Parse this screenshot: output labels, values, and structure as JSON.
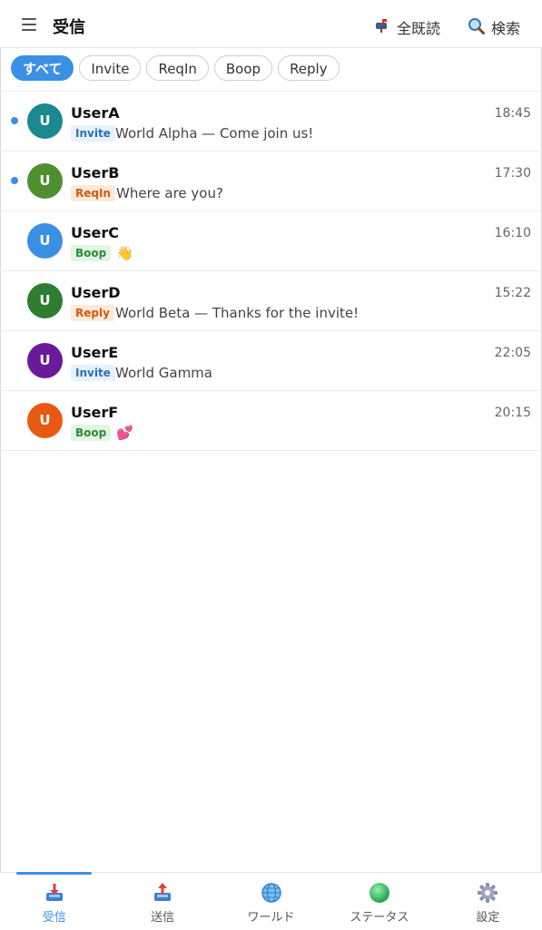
{
  "header": {
    "title": "受信",
    "mark_all_read": "全既読",
    "search": "検索"
  },
  "filters": [
    "すべて",
    "Invite",
    "ReqIn",
    "Boop",
    "Reply"
  ],
  "messages": [
    {
      "user": "UserA",
      "initial": "U",
      "avatar_color": "#1a8a8f",
      "tag": "Invite",
      "text": "World Alpha — Come join us!",
      "time": "18:45",
      "unread": true
    },
    {
      "user": "UserB",
      "initial": "U",
      "avatar_color": "#4f8f2f",
      "tag": "ReqIn",
      "text": "Where are you?",
      "time": "17:30",
      "unread": true
    },
    {
      "user": "UserC",
      "initial": "U",
      "avatar_color": "#3b8fe5",
      "tag": "Boop",
      "text": "👋",
      "time": "16:10",
      "unread": false
    },
    {
      "user": "UserD",
      "initial": "U",
      "avatar_color": "#2e7d32",
      "tag": "Reply",
      "text": "World Beta — Thanks for the invite!",
      "time": "15:22",
      "unread": false
    },
    {
      "user": "UserE",
      "initial": "U",
      "avatar_color": "#6a1b9a",
      "tag": "Invite",
      "text": "World Gamma",
      "time": "22:05",
      "unread": false
    },
    {
      "user": "UserF",
      "initial": "U",
      "avatar_color": "#e85a12",
      "tag": "Boop",
      "text": "💕",
      "time": "20:15",
      "unread": false
    }
  ],
  "nav": {
    "inbox": "受信",
    "outbox": "送信",
    "world": "ワールド",
    "status": "ステータス",
    "settings": "設定"
  },
  "colors": {
    "accent": "#3b8fe5"
  }
}
